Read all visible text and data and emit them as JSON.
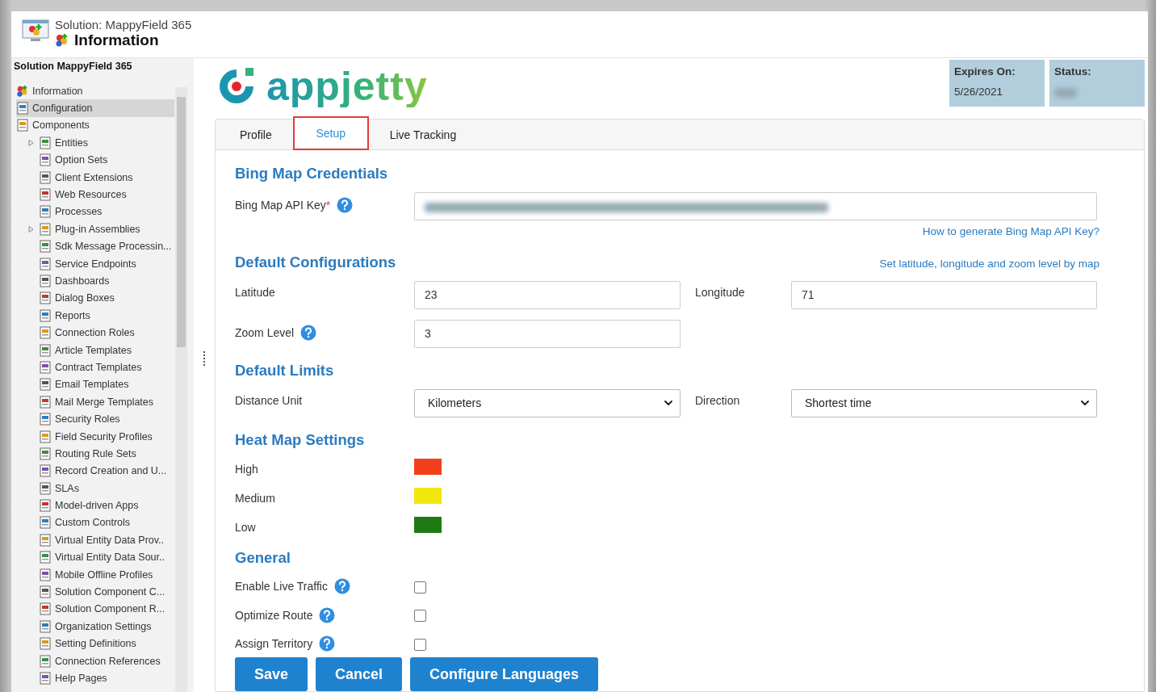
{
  "header": {
    "subtitle": "Solution: MappyField 365",
    "title": "Information"
  },
  "sidebar": {
    "title": "Solution MappyField 365",
    "items": [
      {
        "label": "Information",
        "selected": false
      },
      {
        "label": "Configuration",
        "selected": true
      },
      {
        "label": "Components",
        "selected": false,
        "children": [
          {
            "label": "Entities",
            "selected": false,
            "expanded": false
          },
          {
            "label": "Option Sets",
            "selected": false
          },
          {
            "label": "Client Extensions",
            "selected": false
          },
          {
            "label": "Web Resources",
            "selected": false
          },
          {
            "label": "Processes",
            "selected": false
          },
          {
            "label": "Plug-in Assemblies",
            "selected": false,
            "expanded": false
          },
          {
            "label": "Sdk Message Processin...",
            "selected": false
          },
          {
            "label": "Service Endpoints",
            "selected": false
          },
          {
            "label": "Dashboards",
            "selected": false
          },
          {
            "label": "Dialog Boxes",
            "selected": false
          },
          {
            "label": "Reports",
            "selected": false
          },
          {
            "label": "Connection Roles",
            "selected": false
          },
          {
            "label": "Article Templates",
            "selected": false
          },
          {
            "label": "Contract Templates",
            "selected": false
          },
          {
            "label": "Email Templates",
            "selected": false
          },
          {
            "label": "Mail Merge Templates",
            "selected": false
          },
          {
            "label": "Security Roles",
            "selected": false
          },
          {
            "label": "Field Security Profiles",
            "selected": false
          },
          {
            "label": "Routing Rule Sets",
            "selected": false
          },
          {
            "label": "Record Creation and U...",
            "selected": false
          },
          {
            "label": "SLAs",
            "selected": false
          },
          {
            "label": "Model-driven Apps",
            "selected": false
          },
          {
            "label": "Custom Controls",
            "selected": false
          },
          {
            "label": "Virtual Entity Data Prov..",
            "selected": false
          },
          {
            "label": "Virtual Entity Data Sour..",
            "selected": false
          },
          {
            "label": "Mobile Offline Profiles",
            "selected": false
          },
          {
            "label": "Solution Component C...",
            "selected": false
          },
          {
            "label": "Solution Component R...",
            "selected": false
          },
          {
            "label": "Organization Settings",
            "selected": false
          },
          {
            "label": "Setting Definitions",
            "selected": false
          },
          {
            "label": "Connection References",
            "selected": false
          },
          {
            "label": "Help Pages",
            "selected": false
          }
        ]
      }
    ]
  },
  "logo": {
    "text": "appjetty"
  },
  "info_boxes": [
    {
      "label": "Expires On:",
      "kind": "text",
      "value": "5/26/2021"
    },
    {
      "label": "Status:",
      "kind": "blurred"
    }
  ],
  "tabs": [
    {
      "label": "Profile",
      "selected": false,
      "highlighted": false
    },
    {
      "label": "Setup",
      "selected": true,
      "highlighted": true
    },
    {
      "label": "Live Tracking",
      "selected": false,
      "highlighted": false
    }
  ],
  "sections": [
    {
      "title": "Bing Map Credentials",
      "rows": [
        {
          "kind": "fields",
          "fields": [
            {
              "label": "Bing Map API Key",
              "required_mark": "*",
              "help": true,
              "kind": "blurred",
              "wide": true
            }
          ]
        },
        {
          "kind": "link",
          "text": "How to generate Bing Map API Key?"
        }
      ]
    },
    {
      "title": "Default Configurations",
      "link": "Set latitude, longitude and zoom level by map",
      "rows": [
        {
          "kind": "fields",
          "fields": [
            {
              "label": "Latitude",
              "kind": "input",
              "value": "23"
            },
            {
              "label": "Longitude",
              "kind": "input",
              "value": "71"
            }
          ]
        },
        {
          "kind": "fields",
          "fields": [
            {
              "label": "Zoom Level",
              "help": true,
              "kind": "input",
              "value": "3"
            }
          ]
        }
      ]
    },
    {
      "title": "Default Limits",
      "rows": [
        {
          "kind": "fields",
          "fields": [
            {
              "label": "Distance Unit",
              "kind": "select",
              "value": "Kilometers"
            },
            {
              "label": "Direction",
              "kind": "select",
              "value": "Shortest time"
            }
          ]
        }
      ]
    },
    {
      "title": "Heat Map Settings",
      "rows": [
        {
          "kind": "swatch",
          "label": "High",
          "color": "#f2401d"
        },
        {
          "kind": "swatch",
          "label": "Medium",
          "color": "#f2e60c"
        },
        {
          "kind": "swatch",
          "label": "Low",
          "color": "#1f7a14"
        }
      ]
    },
    {
      "title": "General",
      "rows": [
        {
          "kind": "checkbox",
          "label": "Enable Live Traffic",
          "help": true,
          "checked": false
        },
        {
          "kind": "checkbox",
          "label": "Optimize Route",
          "help": true,
          "checked": false
        },
        {
          "kind": "checkbox",
          "label": "Assign Territory",
          "help": true,
          "checked": false
        }
      ]
    }
  ],
  "buttons": [
    "Save",
    "Cancel",
    "Configure Languages"
  ]
}
